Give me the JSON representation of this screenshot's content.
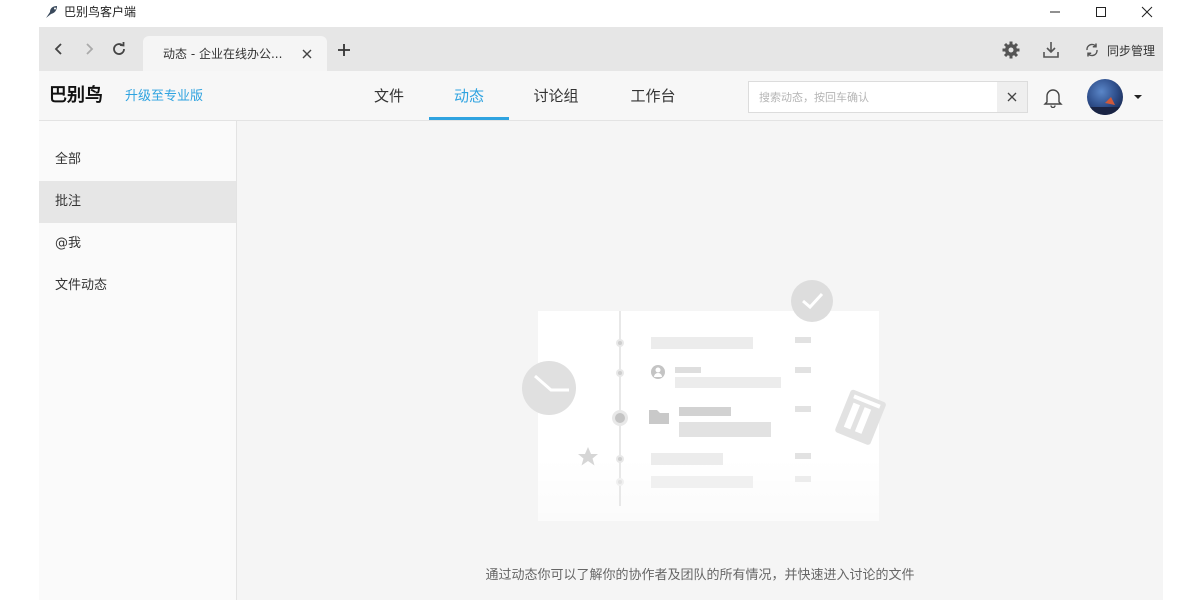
{
  "window": {
    "title": "巴别鸟客户端",
    "icon": "bird-logo-icon"
  },
  "tabbar": {
    "tabs": [
      {
        "label": "动态 - 企业在线办公..."
      }
    ],
    "sync_label": "同步管理"
  },
  "header": {
    "brand": "巴别鸟",
    "upgrade": "升级至专业版",
    "nav": [
      {
        "label": "文件"
      },
      {
        "label": "动态"
      },
      {
        "label": "讨论组"
      },
      {
        "label": "工作台"
      }
    ],
    "active_nav": "动态",
    "search": {
      "placeholder": "搜索动态，按回车确认",
      "value": ""
    }
  },
  "sidebar": {
    "items": [
      {
        "label": "全部"
      },
      {
        "label": "批注"
      },
      {
        "label": "@我"
      },
      {
        "label": "文件动态"
      }
    ],
    "active_item": "批注"
  },
  "main": {
    "empty_message": "通过动态你可以了解你的协作者及团队的所有情况，并快速进入讨论的文件"
  },
  "colors": {
    "accent": "#2fa3e0",
    "tabbar_bg": "#e6e6e6",
    "header_bg": "#f7f7f7",
    "sidebar_bg": "#fafafa",
    "main_bg": "#f5f5f5",
    "active_item_bg": "#e6e6e6"
  }
}
